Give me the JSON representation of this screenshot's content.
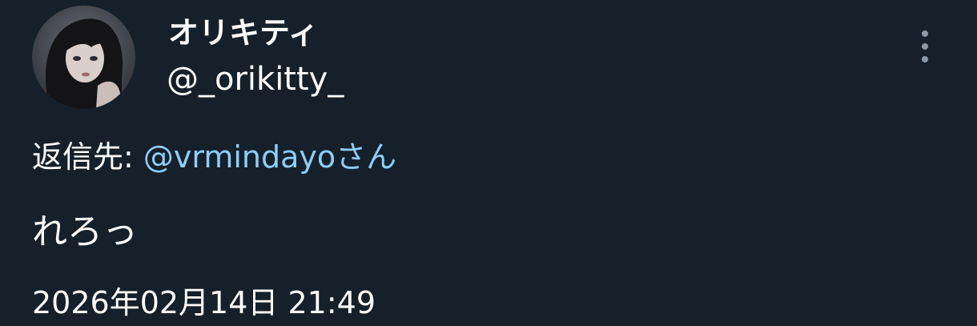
{
  "tweet": {
    "author": {
      "display_name": "オリキティ",
      "handle": "@_orikitty_",
      "avatar_icon": "profile-photo"
    },
    "more_icon": "more-vertical-icon",
    "reply_to": {
      "prefix": "返信先: ",
      "user": "@vrmindayo",
      "suffix": "さん"
    },
    "text": "れろっ",
    "timestamp": "2026年02月14日 21:49"
  },
  "colors": {
    "background": "#15202b",
    "text_primary": "#ffffff",
    "link": "#8ecdf8",
    "icon_secondary": "#8b98a5"
  }
}
